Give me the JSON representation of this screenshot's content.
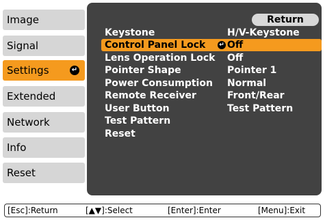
{
  "left_menu": {
    "items": [
      {
        "label": "Image"
      },
      {
        "label": "Signal"
      },
      {
        "label": "Settings",
        "selected": true
      },
      {
        "label": "Extended"
      },
      {
        "label": "Network"
      },
      {
        "label": "Info"
      },
      {
        "label": "Reset"
      }
    ]
  },
  "panel": {
    "return_label": "Return",
    "rows": [
      {
        "label": "Keystone",
        "value": "H/V-Keystone"
      },
      {
        "label": "Control Panel Lock",
        "value": "Off",
        "selected": true
      },
      {
        "label": "Lens Operation Lock",
        "value": "Off"
      },
      {
        "label": "Pointer Shape",
        "value": "Pointer 1"
      },
      {
        "label": "Power Consumption",
        "value": "Normal"
      },
      {
        "label": "Remote Receiver",
        "value": "Front/Rear"
      },
      {
        "label": "User Button",
        "value": "Test Pattern"
      },
      {
        "label": "Test Pattern",
        "value": ""
      },
      {
        "label": "Reset",
        "value": ""
      }
    ]
  },
  "guide": {
    "esc": "[Esc]:Return",
    "select": "[▲▼]:Select",
    "enter": "[Enter]:Enter",
    "menu": "[Menu]:Exit"
  },
  "colors": {
    "accent": "#f59a1e",
    "panel_bg": "#424242",
    "menu_item_bg": "#d6d6d6"
  }
}
